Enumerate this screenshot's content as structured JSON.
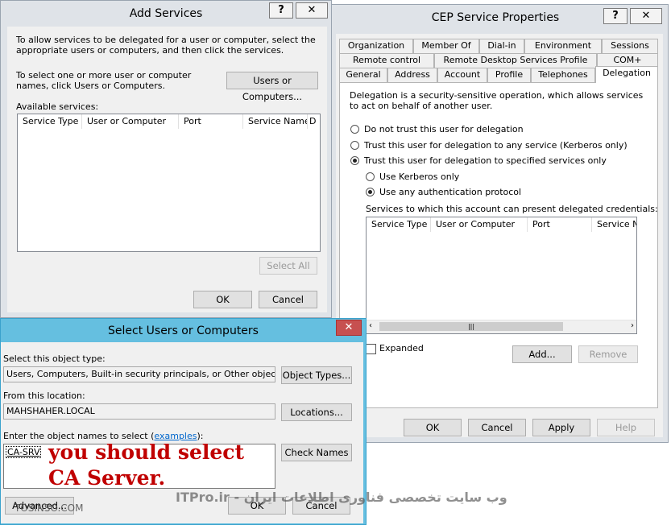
{
  "add_services": {
    "title": "Add Services",
    "help": "?",
    "close": "✕",
    "intro": "To allow services to be delegated for a user or computer, select the appropriate users or computers, and then click the services.",
    "select_text": "To select one or more user or computer names, click Users or Computers.",
    "users_btn": "Users or Computers...",
    "available_label": "Available services:",
    "columns": [
      "Service Type",
      "User or Computer",
      "Port",
      "Service Name",
      "D"
    ],
    "select_all": "Select All",
    "ok": "OK",
    "cancel": "Cancel"
  },
  "cep": {
    "title": "CEP Service Properties",
    "help": "?",
    "close": "✕",
    "tabs_row1": [
      "Organization",
      "Member Of",
      "Dial-in",
      "Environment",
      "Sessions"
    ],
    "tabs_row2": [
      "Remote control",
      "Remote Desktop Services Profile",
      "COM+"
    ],
    "tabs_row3": [
      "General",
      "Address",
      "Account",
      "Profile",
      "Telephones",
      "Delegation"
    ],
    "description": "Delegation is a security-sensitive operation, which allows services to act on behalf of another user.",
    "opt_no": "Do not trust this user for delegation",
    "opt_any": "Trust this user for delegation to any service (Kerberos only)",
    "opt_specified": "Trust this user for delegation to specified services only",
    "opt_kerberos": "Use Kerberos only",
    "opt_anyauth": "Use any authentication protocol",
    "services_label": "Services to which this account can present delegated credentials:",
    "columns": [
      "Service Type",
      "User or Computer",
      "Port",
      "Service Na"
    ],
    "expanded": "Expanded",
    "add": "Add...",
    "remove": "Remove",
    "ok": "OK",
    "cancel": "Cancel",
    "apply": "Apply",
    "help_btn": "Help"
  },
  "select_users": {
    "title": "Select Users or Computers",
    "close": "✕",
    "object_type_label": "Select this object type:",
    "object_type_value": "Users, Computers, Built-in security principals, or Other objects",
    "object_types_btn": "Object Types...",
    "location_label": "From this location:",
    "location_value": "MAHSHAHER.LOCAL",
    "locations_btn": "Locations...",
    "enter_label_prefix": "Enter the object names to select (",
    "enter_label_link": "examples",
    "enter_label_suffix": "):",
    "entered_value": "CA-SRV",
    "check_names": "Check Names",
    "advanced": "Advanced...",
    "ok": "OK",
    "cancel": "Cancel"
  },
  "annotation": {
    "line1": "you should select",
    "line2": "CA Server."
  },
  "watermark": {
    "left": "TOSINSO.COM",
    "right": "ITPro.ir - وب سایت تخصصی فناوری اطلاعات ایران"
  },
  "colors": {
    "dialog_bg": "#f0f0f0",
    "frame": "#dfe3e8",
    "active_frame": "#65bfe0",
    "annotation": "#c00000",
    "close_red": "#c75050"
  }
}
